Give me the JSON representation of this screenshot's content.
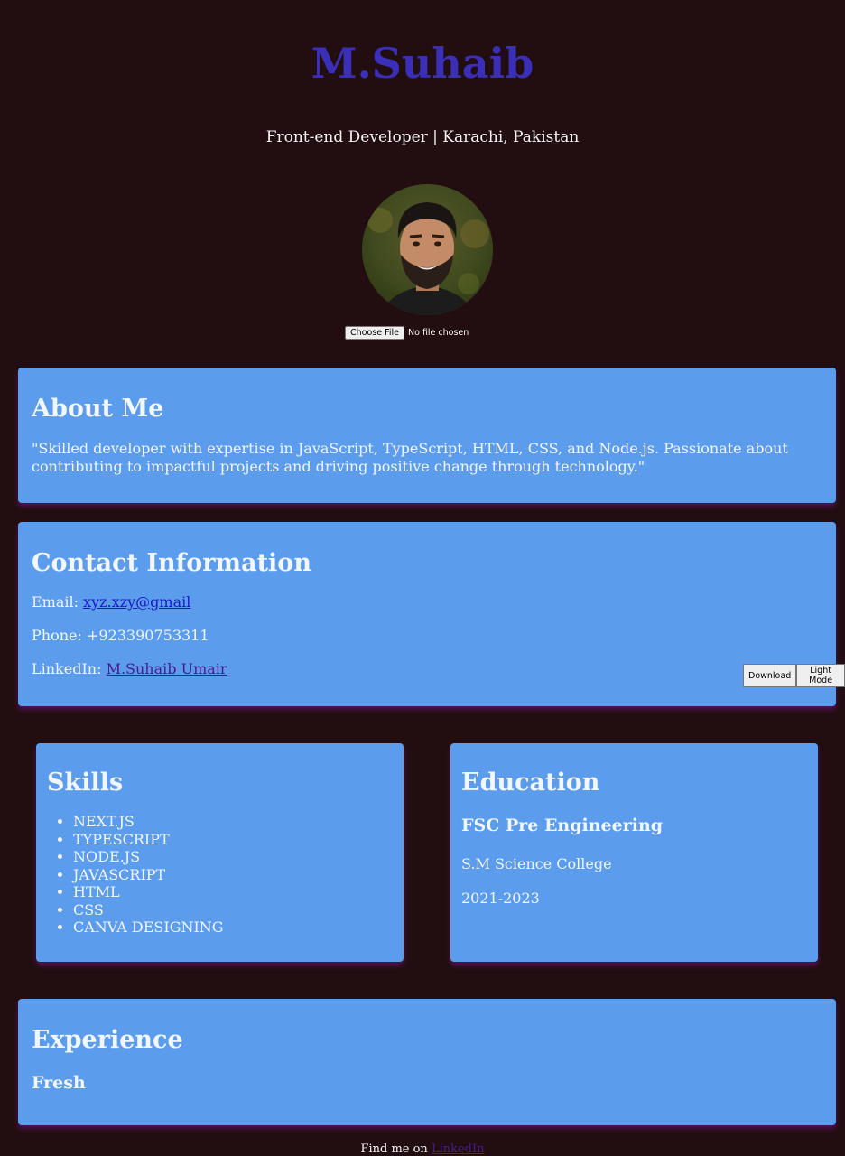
{
  "header": {
    "name": "M.Suhaib",
    "tagline": "Front-end Developer | Karachi, Pakistan"
  },
  "profile": {
    "avatar_icon": "portrait-photo",
    "choose_file_label": "Choose File",
    "file_status": "No file chosen"
  },
  "about": {
    "title": "About Me",
    "text": "\"Skilled developer with expertise in JavaScript, TypeScript, HTML, CSS, and Node.js. Passionate about contributing to impactful projects and driving positive change through technology.\""
  },
  "contact": {
    "title": "Contact Information",
    "email_label": "Email:",
    "email_value": "xyz.xzy@gmail",
    "phone_label": "Phone:",
    "phone_value": "+923390753311",
    "linkedin_label": "LinkedIn:",
    "linkedin_value": "M.Suhaib Umair"
  },
  "actions": {
    "download_label": "Download",
    "theme_label": "Light Mode"
  },
  "skills": {
    "title": "Skills",
    "items": [
      "NEXT.JS",
      "TYPESCRIPT",
      "NODE.JS",
      "JAVASCRIPT",
      "HTML",
      "CSS",
      "CANVA DESIGNING"
    ]
  },
  "education": {
    "title": "Education",
    "degree": "FSC Pre Engineering",
    "school": "S.M Science College",
    "years": "2021-2023"
  },
  "experience": {
    "title": "Experience",
    "level": "Fresh"
  },
  "footer": {
    "prefix": "Find me on",
    "link": "LinkedIn"
  },
  "colors": {
    "background": "#220e10",
    "card": "#5c9ced",
    "name": "#3a2fb8",
    "link": "#1a18c8",
    "visited_link": "#4a1a8c"
  }
}
